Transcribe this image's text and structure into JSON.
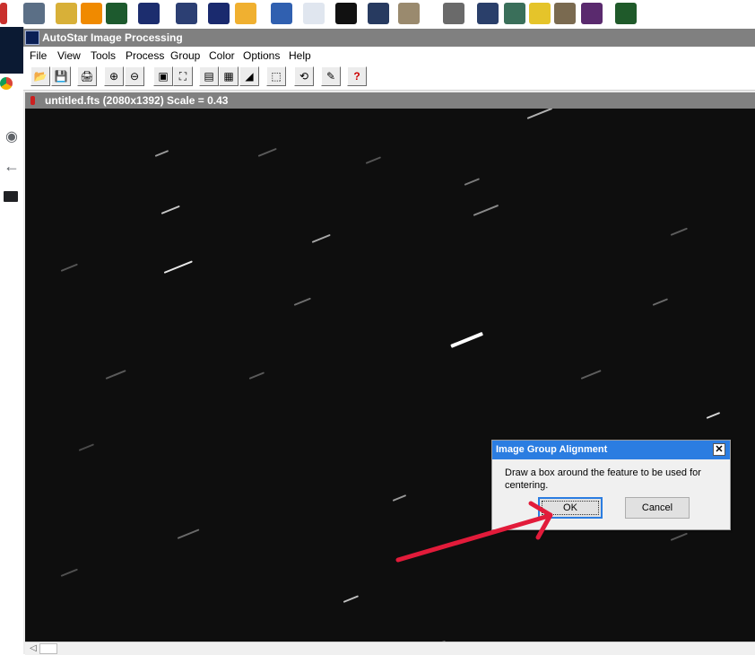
{
  "taskbar_icons": [
    {
      "name": "red-app-icon",
      "color": "#c9302c"
    },
    {
      "name": "camera-icon",
      "color": "#5b6f86"
    },
    {
      "name": "maxim-mascot-icon",
      "color": "#d8b038"
    },
    {
      "name": "vlc-cone-icon",
      "color": "#f08a00"
    },
    {
      "name": "client-star-icon",
      "color": "#1d5a2e"
    },
    {
      "name": "server-star-icon",
      "color": "#1c2d6e"
    },
    {
      "name": "satellite-icon",
      "color": "#2c3f73"
    },
    {
      "name": "galaxy-icon",
      "color": "#1a2a6e"
    },
    {
      "name": "starburst-icon",
      "color": "#f0b030"
    },
    {
      "name": "globe-icon",
      "color": "#3060b0"
    },
    {
      "name": "graph-icon",
      "color": "#e0e6ef"
    },
    {
      "name": "frame-icon",
      "color": "#111111"
    },
    {
      "name": "sky-chart-icon",
      "color": "#273a60"
    },
    {
      "name": "saturn-icon",
      "color": "#9a8a6e"
    },
    {
      "name": "telescope-icon",
      "color": "#6a6a6a"
    },
    {
      "name": "comet-icon",
      "color": "#2a3f6a"
    },
    {
      "name": "puzzle-map-icon",
      "color": "#3a6f5a"
    },
    {
      "name": "cat-icon",
      "color": "#e5c42a"
    },
    {
      "name": "gimp-icon",
      "color": "#7a6a50"
    },
    {
      "name": "purple-app-icon",
      "color": "#5a2a6e"
    },
    {
      "name": "monitor-icon",
      "color": "#1f5a2a"
    }
  ],
  "window": {
    "title": "AutoStar Image Processing"
  },
  "menu": [
    "File",
    "View",
    "Tools",
    "Process",
    "Group",
    "Color",
    "Options",
    "Help"
  ],
  "toolbar": [
    {
      "name": "open-icon",
      "glyph": "📂"
    },
    {
      "name": "save-icon",
      "glyph": "💾"
    },
    {
      "name": "print-icon",
      "glyph": "🖨"
    },
    {
      "name": "zoom-in-icon",
      "glyph": "⊕"
    },
    {
      "name": "zoom-out-icon",
      "glyph": "⊖"
    },
    {
      "name": "fit-window-icon",
      "glyph": "▣"
    },
    {
      "name": "fullscreen-icon",
      "glyph": "⛶"
    },
    {
      "name": "color-palette-icon",
      "glyph": "▤"
    },
    {
      "name": "grid-icon",
      "glyph": "▦"
    },
    {
      "name": "histogram-icon",
      "glyph": "◢"
    },
    {
      "name": "crop-icon",
      "glyph": "⬚"
    },
    {
      "name": "rotate-icon",
      "glyph": "⟲"
    },
    {
      "name": "script-icon",
      "glyph": "✎"
    },
    {
      "name": "help-icon",
      "glyph": "?"
    }
  ],
  "image_window": {
    "title": "untitled.fts (2080x1392)  Scale = 0.43"
  },
  "dialog": {
    "title": "Image Group Alignment",
    "close": "✕",
    "message": "Draw a box around the feature to be used for centering.",
    "ok": "OK",
    "cancel": "Cancel"
  },
  "colors": {
    "annotation_arrow": "#e21b3a",
    "dialog_title": "#2b7de1"
  }
}
